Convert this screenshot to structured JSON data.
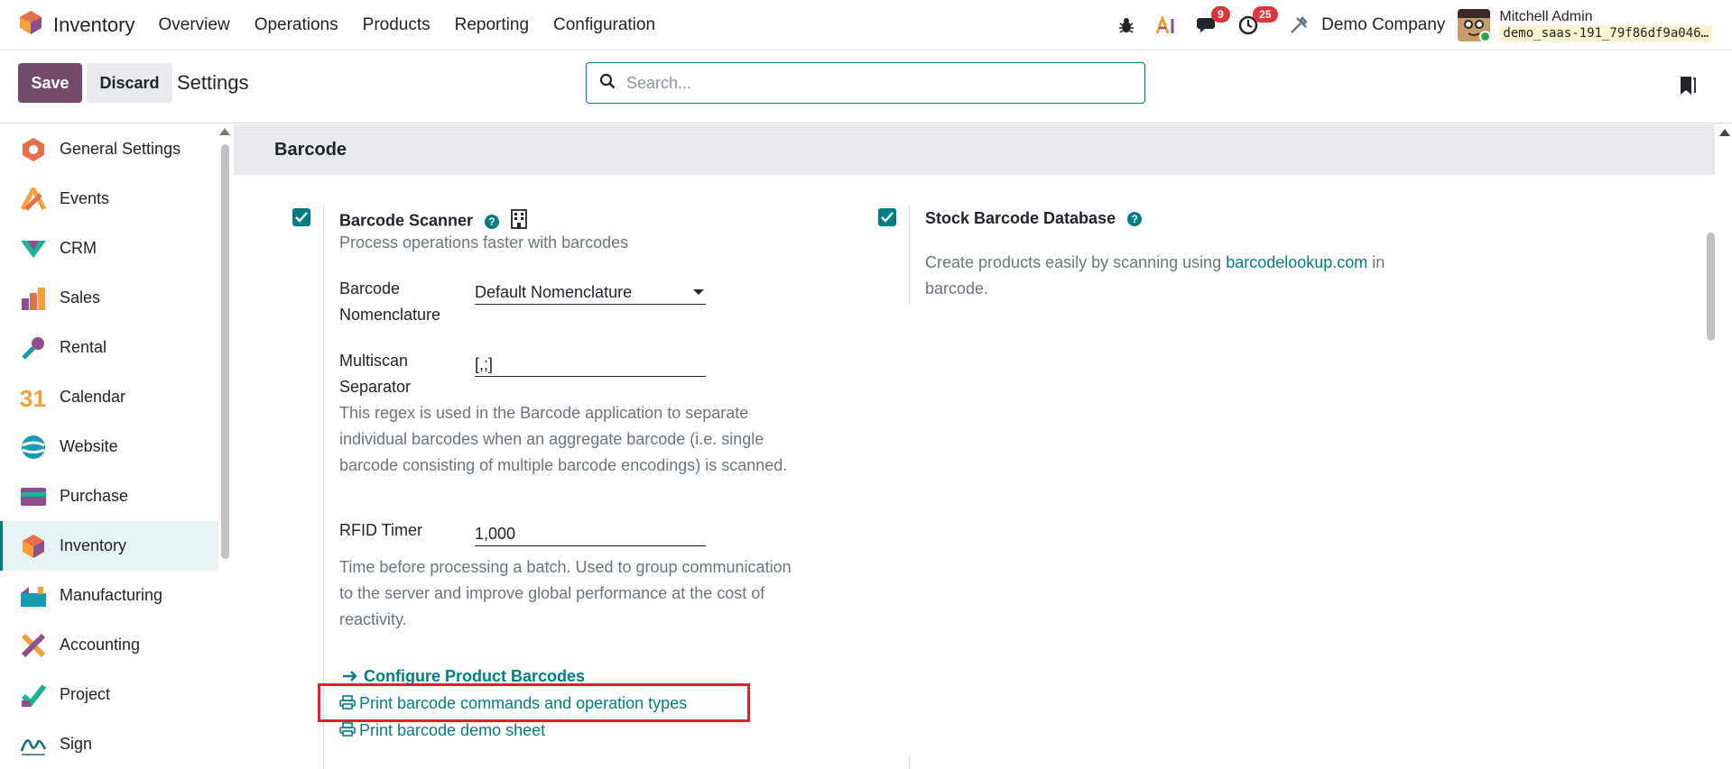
{
  "navbar": {
    "app_name": "Inventory",
    "menu": [
      "Overview",
      "Operations",
      "Products",
      "Reporting",
      "Configuration"
    ],
    "messages_count": "9",
    "activities_count": "25",
    "company": "Demo Company",
    "user_name": "Mitchell Admin",
    "user_db": "demo_saas-191_79f86df9a046…"
  },
  "controls": {
    "save_label": "Save",
    "discard_label": "Discard",
    "title": "Settings",
    "search_placeholder": "Search..."
  },
  "sidebar": {
    "items": [
      {
        "label": "General Settings",
        "icon": "general-settings-icon"
      },
      {
        "label": "Events",
        "icon": "events-icon"
      },
      {
        "label": "CRM",
        "icon": "crm-icon"
      },
      {
        "label": "Sales",
        "icon": "sales-icon"
      },
      {
        "label": "Rental",
        "icon": "rental-icon"
      },
      {
        "label": "Calendar",
        "icon": "calendar-icon"
      },
      {
        "label": "Website",
        "icon": "website-icon"
      },
      {
        "label": "Purchase",
        "icon": "purchase-icon"
      },
      {
        "label": "Inventory",
        "icon": "inventory-icon"
      },
      {
        "label": "Manufacturing",
        "icon": "manufacturing-icon"
      },
      {
        "label": "Accounting",
        "icon": "accounting-icon"
      },
      {
        "label": "Project",
        "icon": "project-icon"
      },
      {
        "label": "Sign",
        "icon": "sign-icon"
      }
    ],
    "active": "Inventory"
  },
  "section": {
    "title": "Barcode",
    "barcode_scanner": {
      "title": "Barcode Scanner",
      "description": "Process operations faster with barcodes",
      "nomenclature_label_1": "Barcode",
      "nomenclature_label_2": "Nomenclature",
      "nomenclature_value": "Default Nomenclature",
      "multiscan_label_1": "Multiscan",
      "multiscan_label_2": "Separator",
      "multiscan_value": "[,;]",
      "multiscan_help_1": "This regex is used in the Barcode application to separate",
      "multiscan_help_2": "individual barcodes when an aggregate barcode (i.e. single",
      "multiscan_help_3": "barcode consisting of multiple barcode encodings) is scanned.",
      "rfid_label": "RFID Timer",
      "rfid_value": "1,000",
      "rfid_help_1": "Time before processing a batch. Used to group communication",
      "rfid_help_2": "to the server and improve global performance at the cost of",
      "rfid_help_3": "reactivity.",
      "link_configure": "Configure Product Barcodes",
      "link_print_commands": "Print barcode commands and operation types",
      "link_print_demo": "Print barcode demo sheet"
    },
    "stock_barcode_db": {
      "title": "Stock Barcode Database",
      "desc_prefix": "Create products easily by scanning using ",
      "desc_link": "barcodelookup.com",
      "desc_suffix": " in",
      "desc_line2": "barcode."
    }
  },
  "colors": {
    "brand": "#714b67",
    "accent": "#017e84",
    "highlight": "#e0202a"
  }
}
